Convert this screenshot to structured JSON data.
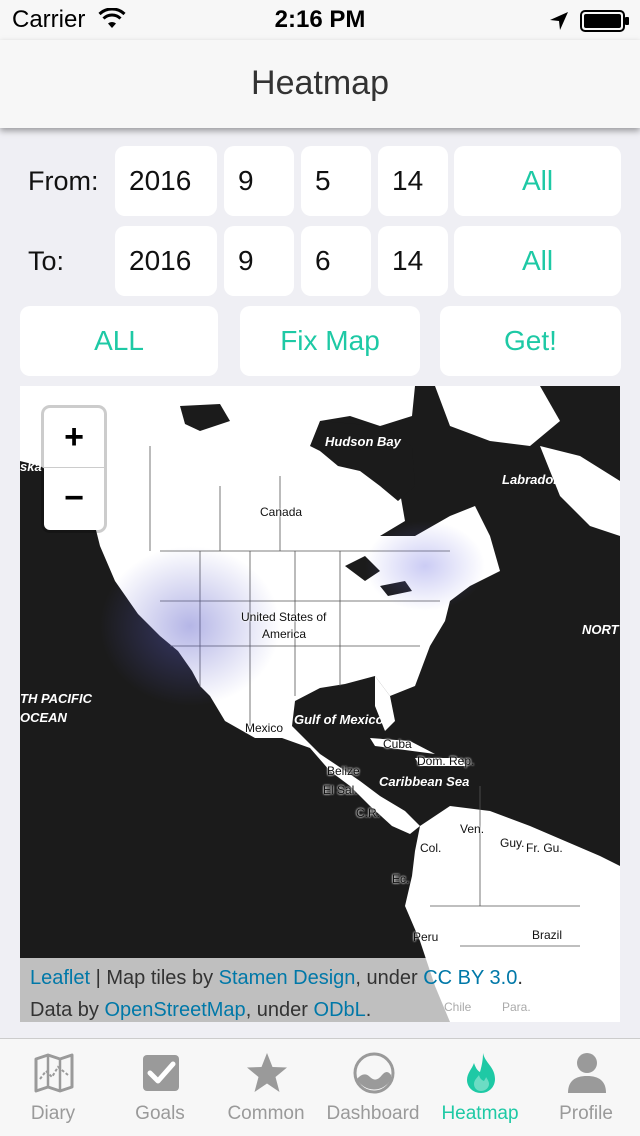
{
  "status_bar": {
    "carrier": "Carrier",
    "time": "2:16 PM"
  },
  "nav": {
    "title": "Heatmap"
  },
  "form": {
    "from": {
      "label": "From:",
      "year": "2016",
      "month": "9",
      "day": "5",
      "hour": "14",
      "all_label": "All"
    },
    "to": {
      "label": "To:",
      "year": "2016",
      "month": "9",
      "day": "6",
      "hour": "14",
      "all_label": "All"
    },
    "buttons": {
      "all": "ALL",
      "fix_map": "Fix Map",
      "get": "Get!"
    }
  },
  "map": {
    "zoom_in": "+",
    "zoom_out": "−",
    "labels": {
      "hudson_bay": "Hudson Bay",
      "labrador_sea": "Labrador Sea",
      "alaska": "ska",
      "canada": "Canada",
      "usa_line1": "United States of",
      "usa_line2": "America",
      "north": "NORT",
      "south_pacific_line1": "TH PACIFIC",
      "south_pacific_line2": "OCEAN",
      "mexico": "Mexico",
      "gulf_of_mexico": "Gulf of Mexico",
      "cuba": "Cuba",
      "dom_rep": "Dom. Rep.",
      "belize": "Belize",
      "caribbean_sea": "Caribbean Sea",
      "el_sal": "El Sal.",
      "cr": "C.R.",
      "ven": "Ven.",
      "col": "Col.",
      "guy": "Guy.",
      "fr_gu": "Fr. Gu.",
      "ec": "Ec.",
      "peru": "Peru",
      "brazil": "Brazil",
      "chile": "Chile",
      "para": "Para."
    },
    "attribution": {
      "leaflet": "Leaflet",
      "sep": " | Map tiles by ",
      "stamen": "Stamen Design",
      "under1": ", under ",
      "ccby": "CC BY 3.0",
      "dot1": ".",
      "data_by": "Data by ",
      "osm": "OpenStreetMap",
      "under2": ", under ",
      "odbl": "ODbL",
      "dot2": "."
    }
  },
  "tabs": [
    {
      "label": "Diary",
      "icon": "map-fold-icon"
    },
    {
      "label": "Goals",
      "icon": "checkbox-icon"
    },
    {
      "label": "Common",
      "icon": "star-icon"
    },
    {
      "label": "Dashboard",
      "icon": "gauge-icon"
    },
    {
      "label": "Heatmap",
      "icon": "flame-icon",
      "active": true
    },
    {
      "label": "Profile",
      "icon": "person-icon"
    }
  ],
  "colors": {
    "accent": "#1ec9a5",
    "inactive": "#9a9a9a",
    "link": "#0078a8"
  }
}
